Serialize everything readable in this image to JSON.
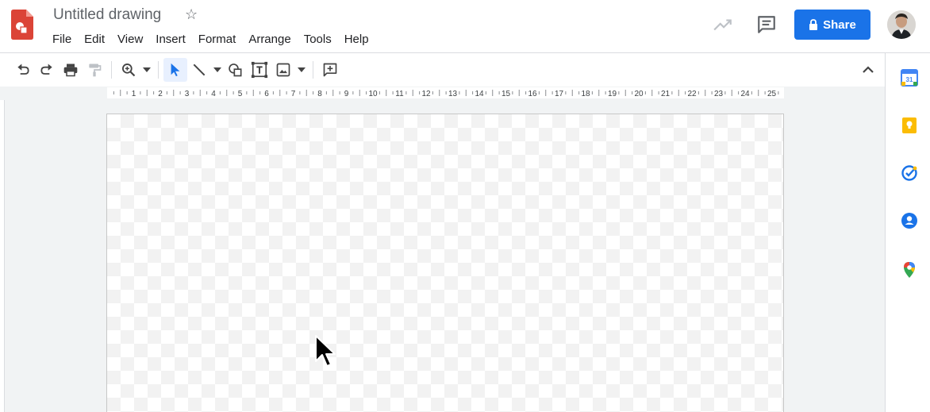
{
  "app": {
    "title": "Untitled drawing"
  },
  "menu": [
    "File",
    "Edit",
    "View",
    "Insert",
    "Format",
    "Arrange",
    "Tools",
    "Help"
  ],
  "share": {
    "label": "Share"
  },
  "ruler": {
    "numbers": [
      "1",
      "2",
      "3",
      "4",
      "5",
      "6",
      "7",
      "8",
      "9",
      "10",
      "11",
      "12",
      "13",
      "14",
      "15",
      "16",
      "17",
      "18",
      "19",
      "20",
      "21",
      "22",
      "23",
      "24",
      "25"
    ]
  },
  "toolbar": {
    "icons": [
      "undo-icon",
      "redo-icon",
      "print-icon",
      "paint-format-icon",
      "zoom-icon",
      "select-icon",
      "line-icon",
      "shape-icon",
      "text-box-icon",
      "image-icon",
      "comment-add-icon"
    ]
  },
  "side_panel": {
    "icons": [
      "calendar-icon",
      "keep-icon",
      "tasks-icon",
      "contacts-icon",
      "maps-icon"
    ],
    "calendar_day": "31"
  },
  "colors": {
    "accent": "#1a73e8",
    "drawings_red": "#db4437"
  }
}
